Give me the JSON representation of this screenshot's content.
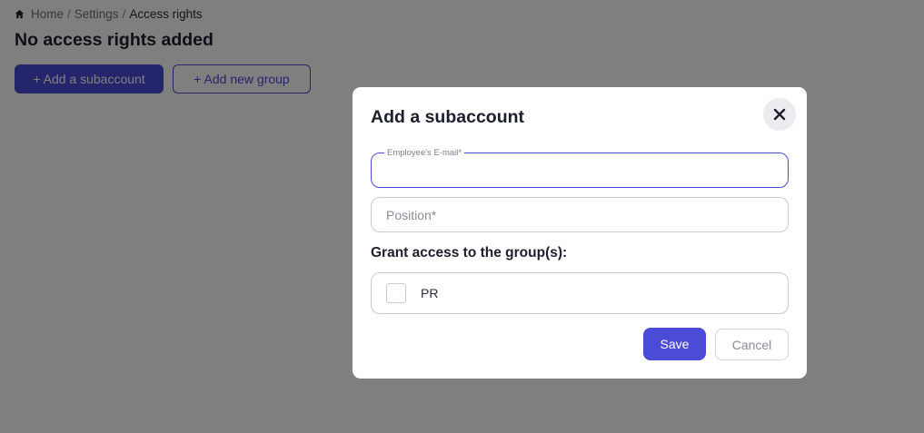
{
  "breadcrumb": {
    "home": "Home",
    "settings": "Settings",
    "current": "Access rights",
    "separator": "/"
  },
  "page": {
    "title": "No access rights added",
    "add_subaccount_label": "+ Add a subaccount",
    "add_group_label": "+ Add new group"
  },
  "modal": {
    "title": "Add a subaccount",
    "email_label": "Employee's E-mail*",
    "email_value": "",
    "position_placeholder": "Position*",
    "groups_heading": "Grant access to the group(s):",
    "groups": [
      {
        "label": "PR",
        "checked": false
      }
    ],
    "save_label": "Save",
    "cancel_label": "Cancel"
  },
  "colors": {
    "accent": "#4b4bd8",
    "overlay": "rgba(0,0,0,0.5)"
  },
  "icons": {
    "home": "home-icon",
    "close": "close-icon"
  }
}
